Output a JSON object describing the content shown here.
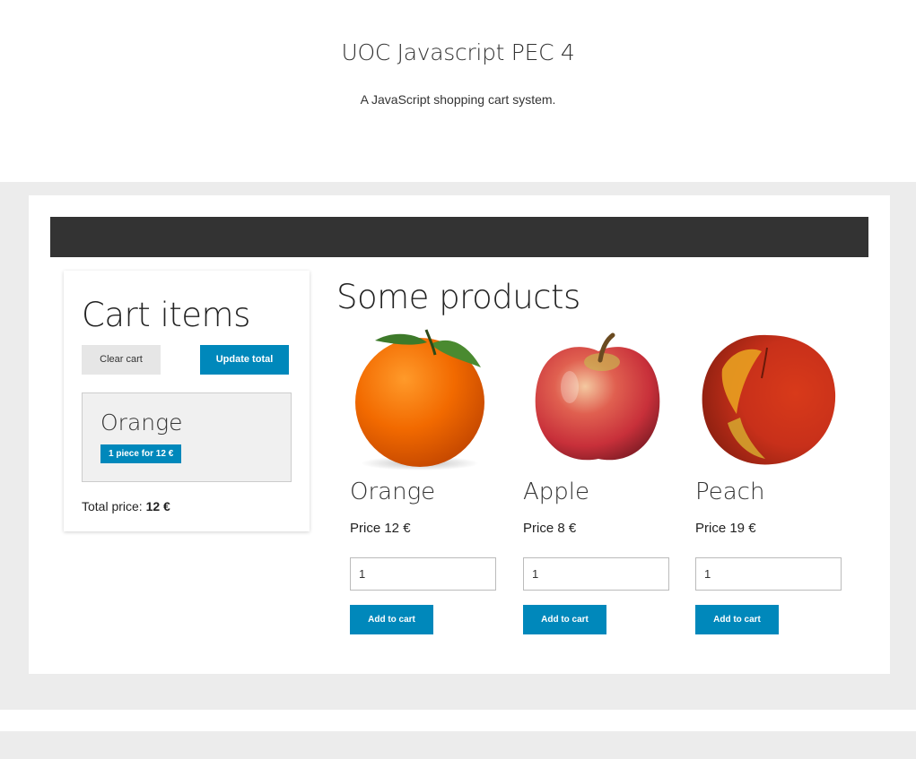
{
  "header": {
    "title": "UOC Javascript PEC 4",
    "subtitle": "A JavaScript shopping cart system."
  },
  "cart": {
    "title": "Cart items",
    "clear_label": "Clear cart",
    "update_label": "Update total",
    "items": [
      {
        "name": "Orange",
        "badge": "1 piece for 12 €"
      }
    ],
    "total_label": "Total price: ",
    "total_value": "12 €"
  },
  "products": {
    "title": "Some products",
    "items": [
      {
        "name": "Orange",
        "price": "Price 12 €",
        "quantity": "1",
        "button": "Add to cart",
        "image": "orange-image"
      },
      {
        "name": "Apple",
        "price": "Price 8 €",
        "quantity": "1",
        "button": "Add to cart",
        "image": "apple-image"
      },
      {
        "name": "Peach",
        "price": "Price 19 €",
        "quantity": "1",
        "button": "Add to cart",
        "image": "peach-image"
      }
    ]
  },
  "colors": {
    "accent": "#0088bb",
    "navbar": "#333333",
    "band": "#ececec"
  }
}
